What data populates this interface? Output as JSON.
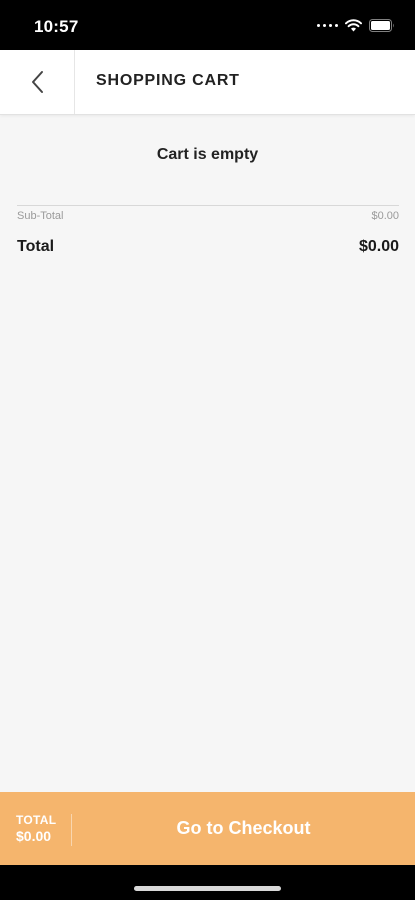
{
  "status_bar": {
    "time": "10:57"
  },
  "header": {
    "title": "SHOPPING CART",
    "back_icon": "chevron-left-icon"
  },
  "cart": {
    "empty_message": "Cart is empty",
    "subtotal_label": "Sub-Total",
    "subtotal_value": "$0.00",
    "total_label": "Total",
    "total_value": "$0.00"
  },
  "footer": {
    "total_label": "TOTAL",
    "total_amount": "$0.00",
    "checkout_label": "Go to Checkout"
  },
  "colors": {
    "accent": "#f5b56d",
    "background": "#f6f6f6"
  }
}
